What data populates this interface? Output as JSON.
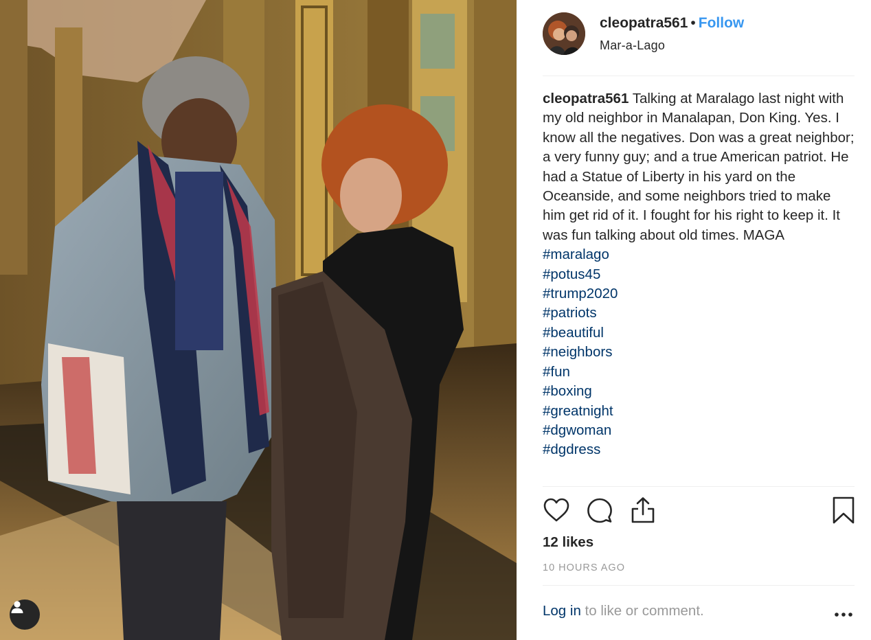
{
  "post": {
    "owner": {
      "username": "cleopatra561",
      "separator": "•",
      "follow_label": "Follow",
      "location": "Mar-a-Lago"
    },
    "caption": {
      "username": "cleopatra561",
      "text": "Talking at Maralago last night with my old neighbor in Manalapan, Don King. Yes. I know all the negatives. Don was a great neighbor; a very funny guy; and a true American patriot. He had a Statue of Liberty in his yard on the Oceanside, and some neighbors tried to make him get rid of it. I fought for his right to keep it. It was fun talking about old times. MAGA",
      "hashtags": [
        "#maralago",
        "#potus45",
        "#trump2020",
        "#patriots",
        "#beautiful",
        "#neighbors",
        "#fun",
        "#boxing",
        "#greatnight",
        "#dgwoman",
        "#dgdress"
      ]
    },
    "actions": [
      "heart-icon",
      "comment-icon",
      "share-icon",
      "bookmark-icon"
    ],
    "likes": "12 likes",
    "timestamp": "10 HOURS AGO",
    "footer": {
      "login_label": "Log in",
      "rest": " to like or comment."
    }
  },
  "colors": {
    "link_blue": "#3897f0",
    "hashtag": "#003569",
    "muted": "#999999",
    "text": "#262626"
  }
}
